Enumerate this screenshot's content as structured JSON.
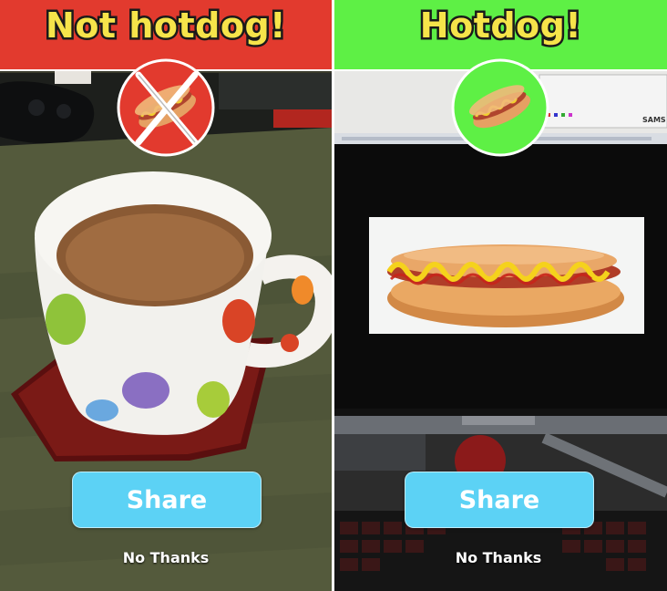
{
  "left": {
    "title": "Not hotdog!",
    "share_label": "Share",
    "dismiss_label": "No Thanks",
    "banner_color": "#E23A2E"
  },
  "right": {
    "title": "Hotdog!",
    "share_label": "Share",
    "dismiss_label": "No Thanks",
    "banner_color": "#5EF045",
    "monitor_brand": "SAMS"
  },
  "icons": [
    "hotdog-icon",
    "cross-icon"
  ],
  "colors": {
    "button": "#5CD2F5",
    "title_text": "#F6E44A",
    "not_hotdog": "#E23A2E",
    "hotdog": "#5EF045"
  }
}
